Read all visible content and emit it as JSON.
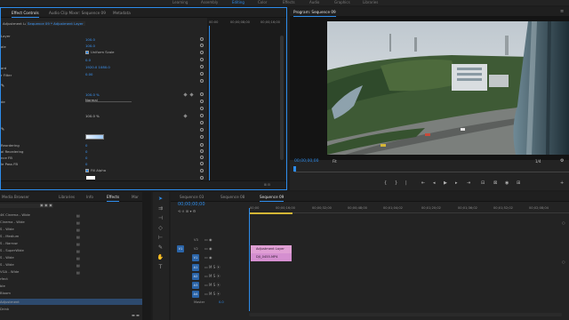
{
  "workspaces": [
    "Learning",
    "Assembly",
    "Editing",
    "Color",
    "Effects",
    "Audio",
    "Graphics",
    "Libraries"
  ],
  "workspace_active": "Editing",
  "top_tabs": {
    "effect_controls": "Effect Controls",
    "audio_mixer": "Audio Clip Mixer: Sequence 09",
    "metadata": "Metadata",
    "program": "Program: Sequence 09"
  },
  "effect_controls": {
    "clip_source": "Adjustment Layer",
    "clip_target": "Sequence 09 * Adjustment Layer",
    "ruler_times": [
      "00:00",
      "00;00;08;00",
      "00;00;16;00"
    ],
    "params": [
      {
        "label": "",
        "value": "100.0"
      },
      {
        "label": "",
        "value": "100.0"
      },
      {
        "label": "",
        "value": "Uniform Scale"
      },
      {
        "label": "",
        "value": "0.0"
      },
      {
        "label": "",
        "value": "1920.0    1080.0"
      },
      {
        "label": "",
        "value": "0.00"
      },
      {
        "label": "",
        "value": "100.0 %"
      },
      {
        "label": "",
        "value": "Normal"
      },
      {
        "label": "",
        "value": "100.0 %"
      },
      {
        "label": "",
        "value": "0"
      },
      {
        "label": "",
        "value": "0"
      },
      {
        "label": "",
        "value": "0"
      },
      {
        "label": "",
        "value": "0"
      },
      {
        "label": "",
        "value": "Fill Alpha"
      }
    ],
    "labels_left": [
      "Layer",
      "ale",
      "",
      "ard",
      "r Filter",
      "",
      "",
      "de",
      "",
      "",
      "",
      "Reordering",
      "al Reordering",
      "nce FB",
      "le Pass FB"
    ],
    "footer_time": "00;00;00;00"
  },
  "program_monitor": {
    "timecode": "00;00;00;00",
    "fit": "Fit",
    "resolution": "1/4",
    "duration": "00;00;00;00"
  },
  "bottom_left_tabs": [
    "Media Browser",
    "Libraries",
    "Info",
    "Effects",
    "Mar"
  ],
  "bottom_left_active": "Effects",
  "effects_list": [
    "4K Cinema - Wide",
    "Cinema - Wide",
    "S - Wide",
    "S - Medium",
    "S - Narrow",
    "S - SuperWide",
    "S - Wide",
    "S - Wide",
    "VGA - Wide",
    "rfect",
    "ble",
    "Bloom",
    "Adjustment",
    "Drink"
  ],
  "sequence_tabs": [
    "Sequence 03",
    "Sequence 08",
    "Sequence 09"
  ],
  "sequence_active": "Sequence 09",
  "timeline": {
    "timecode": "00;00;00;00",
    "ruler": [
      "00;00",
      "00;00;16;00",
      "00;00;32;00",
      "00;00;48;00",
      "00;01;04;02",
      "00;01;20;02",
      "00;01;36;02",
      "00;01;52;02",
      "00;02;08;04"
    ],
    "video_tracks": [
      "V3",
      "V2",
      "V1"
    ],
    "audio_tracks": [
      "A1",
      "A2",
      "A3",
      "A4"
    ],
    "master": "Master",
    "master_value": "0.0",
    "clips": [
      {
        "name": "Adjustment Layer",
        "track": "V2"
      },
      {
        "name": "DJI_0455.MP4",
        "track": "V1"
      }
    ]
  },
  "colors": {
    "accent": "#2d8ceb",
    "clip_adjustment": "#e09fd4",
    "clip_video": "#d58fd0"
  }
}
